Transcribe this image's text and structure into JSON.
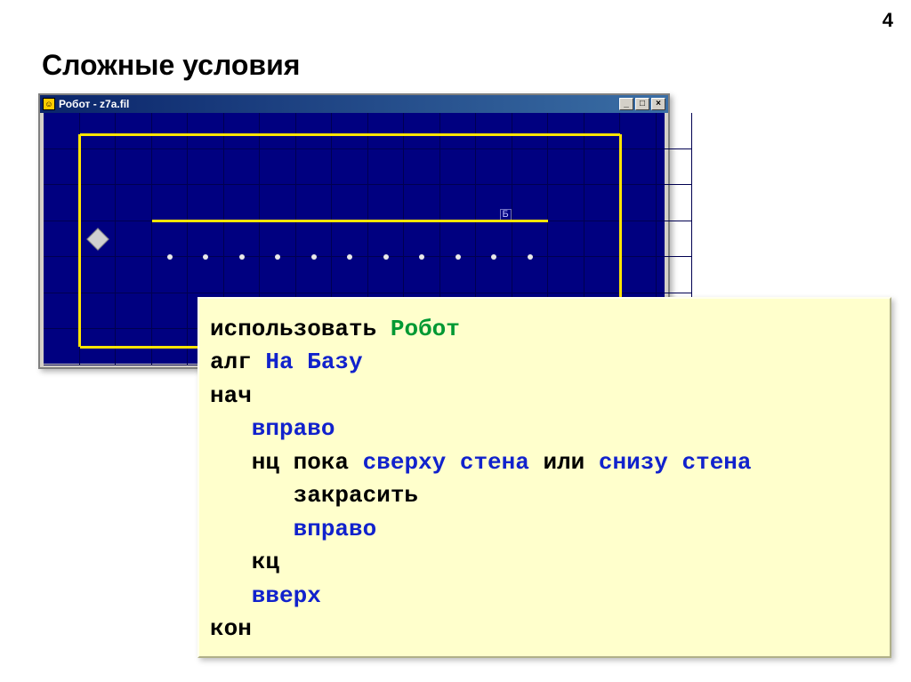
{
  "slide": {
    "number": "4",
    "title": "Сложные условия"
  },
  "window": {
    "title": "Робот - z7a.fil",
    "icon_glyph": "☺",
    "buttons": {
      "minimize": "_",
      "maximize": "□",
      "close": "×"
    },
    "base_label": "Б"
  },
  "grid": {
    "cols": 17,
    "rows": 7,
    "cell": 40.5,
    "robot": {
      "col": 1,
      "row": 3
    },
    "dots_row": 4,
    "dots_cols": [
      3,
      4,
      5,
      6,
      7,
      8,
      9,
      10,
      11,
      12,
      13
    ],
    "base": {
      "col": 12,
      "row": 2
    },
    "walls": {
      "outer_top": 0.6,
      "outer_left": 1,
      "outer_right": 16,
      "outer_bottom_partial": false,
      "mid_row": 3,
      "mid_from": 3,
      "mid_to": 14
    }
  },
  "code": {
    "l1_a": "использовать ",
    "l1_b": "Робот",
    "l2_a": "алг ",
    "l2_b": "На Базу",
    "l3": "нач",
    "l4": "   вправо",
    "l5_a": "   нц пока",
    "l5_b": " сверху стена ",
    "l5_c": "или",
    "l5_d": " снизу стена",
    "l6": "      закрасить",
    "l7": "      вправо",
    "l8": "   кц",
    "l9": "   вверх",
    "l10": "кон"
  }
}
